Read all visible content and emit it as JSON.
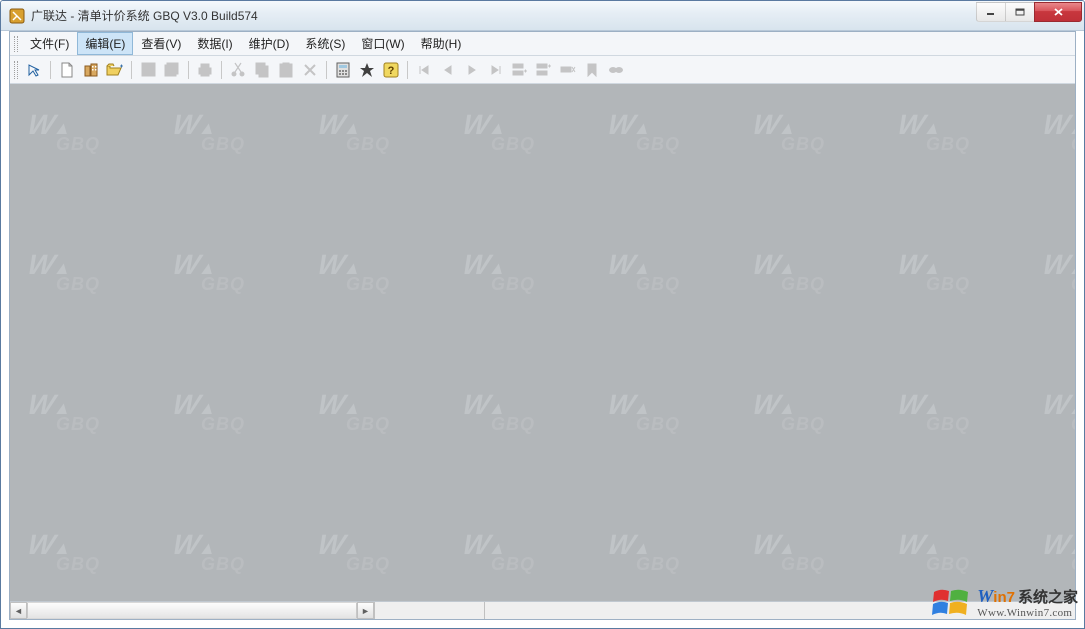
{
  "window": {
    "title": "广联达 - 清单计价系统 GBQ V3.0 Build574"
  },
  "menubar": {
    "items": [
      {
        "label": "文件(F)"
      },
      {
        "label": "编辑(E)",
        "active": true
      },
      {
        "label": "查看(V)"
      },
      {
        "label": "数据(I)"
      },
      {
        "label": "维护(D)"
      },
      {
        "label": "系统(S)"
      },
      {
        "label": "窗口(W)"
      },
      {
        "label": "帮助(H)"
      }
    ]
  },
  "watermark": {
    "text": "GBQ"
  },
  "brand": {
    "line1_w": "W",
    "line1_in7": "in7",
    "line1_cn": "系统之家",
    "line2": "Www.Winwin7.com"
  }
}
